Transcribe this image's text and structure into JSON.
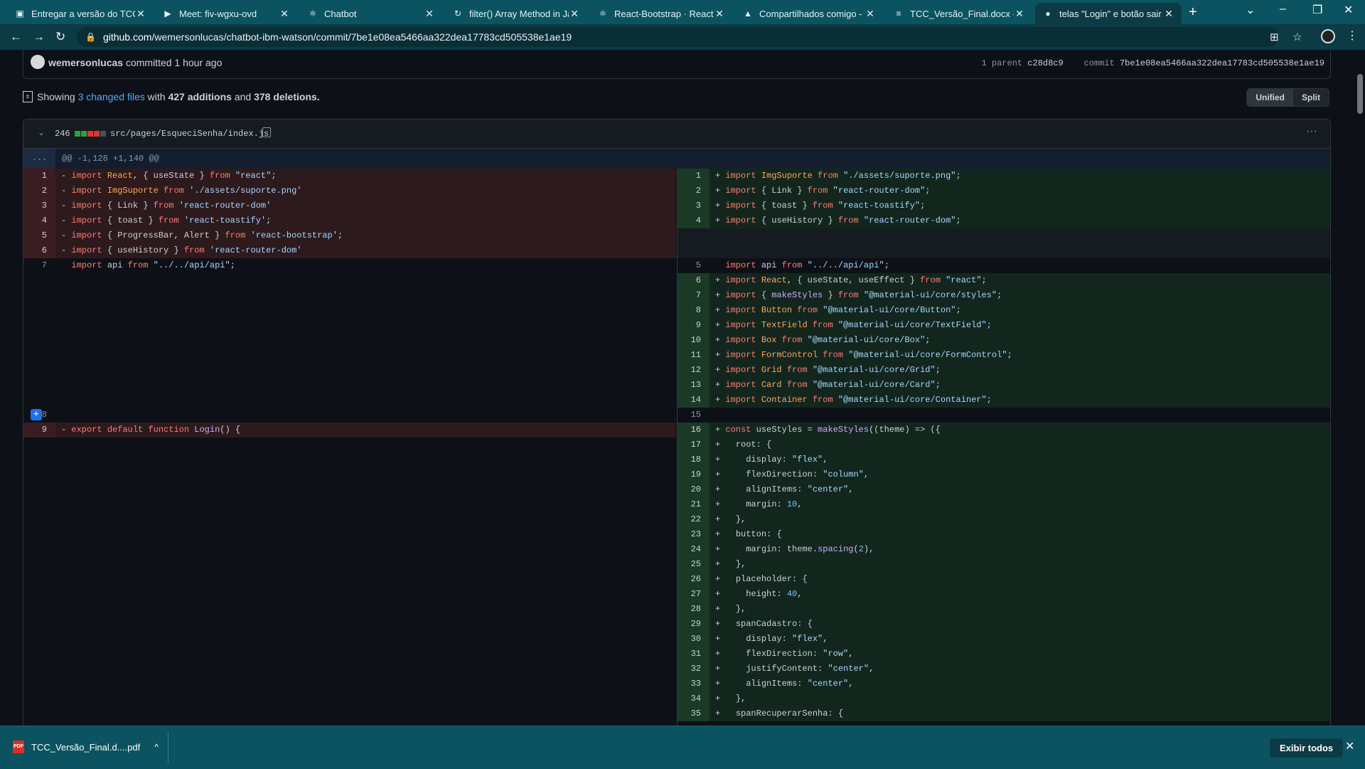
{
  "browser": {
    "tabs": [
      {
        "title": "Entregar a versão do TCC c",
        "icon": "classroom-icon"
      },
      {
        "title": "Meet: fiv-wgxu-ovd",
        "icon": "meet-icon"
      },
      {
        "title": "Chatbot",
        "icon": "react-icon"
      },
      {
        "title": "filter() Array Method in Jav",
        "icon": "refresh-icon"
      },
      {
        "title": "React-Bootstrap · React-Bo",
        "icon": "react-icon"
      },
      {
        "title": "Compartilhados comigo - ",
        "icon": "drive-icon"
      },
      {
        "title": "TCC_Versão_Final.docx - D",
        "icon": "docs-icon"
      },
      {
        "title": "telas \"Login\" e botão sair c",
        "icon": "github-icon"
      }
    ],
    "url_host": "github.com",
    "url_path": "/wemersonlucas/chatbot-ibm-watson/commit/7be1e08ea5466aa322dea17783cd505538e1ae19"
  },
  "commit": {
    "author": "wemersonlucas",
    "committed": "committed 1 hour ago",
    "parent_label": "1 parent",
    "parent_sha": "c28d8c9",
    "commit_label": "commit",
    "commit_sha": "7be1e08ea5466aa322dea17783cd505538e1ae19"
  },
  "summary": {
    "showing": "Showing",
    "changed": "3 changed files",
    "with": "with",
    "additions": "427 additions",
    "and": "and",
    "deletions": "378 deletions."
  },
  "view": {
    "unified": "Unified",
    "split": "Split"
  },
  "file": {
    "count": "246",
    "path": "src/pages/EsqueciSenha/index.js",
    "hunk_dots": "...",
    "hunk": "@@ -1,128 +1,140 @@",
    "left_lines": [
      {
        "n": "1",
        "t": "del",
        "code": "- import React, { useState } from \"react\";"
      },
      {
        "n": "2",
        "t": "del",
        "code": "- import ImgSuporte from './assets/suporte.png'"
      },
      {
        "n": "3",
        "t": "del",
        "code": "- import { Link } from 'react-router-dom'"
      },
      {
        "n": "4",
        "t": "del",
        "code": "- import { toast } from 'react-toastify';"
      },
      {
        "n": "5",
        "t": "del",
        "code": "- import { ProgressBar, Alert } from 'react-bootstrap';"
      },
      {
        "n": "6",
        "t": "del",
        "code": "- import { useHistory } from 'react-router-dom'"
      },
      {
        "n": "7",
        "t": "ctx",
        "code": "  import api from \"../../api/api\";"
      },
      {
        "n": "",
        "t": "blank",
        "code": ""
      },
      {
        "n": "",
        "t": "blank",
        "code": ""
      },
      {
        "n": "",
        "t": "blank",
        "code": ""
      },
      {
        "n": "",
        "t": "blank",
        "code": ""
      },
      {
        "n": "",
        "t": "blank",
        "code": ""
      },
      {
        "n": "",
        "t": "blank",
        "code": ""
      },
      {
        "n": "",
        "t": "blank",
        "code": ""
      },
      {
        "n": "",
        "t": "blank",
        "code": ""
      },
      {
        "n": "",
        "t": "blank",
        "code": ""
      },
      {
        "n": "8",
        "t": "ctx",
        "code": "",
        "expand": "+"
      },
      {
        "n": "9",
        "t": "del",
        "code": "- export default function Login() {"
      }
    ],
    "right_lines": [
      {
        "n": "1",
        "t": "add",
        "code": "+ import ImgSuporte from \"./assets/suporte.png\";"
      },
      {
        "n": "2",
        "t": "add",
        "code": "+ import { Link } from \"react-router-dom\";"
      },
      {
        "n": "3",
        "t": "add",
        "code": "+ import { toast } from \"react-toastify\";"
      },
      {
        "n": "4",
        "t": "add",
        "code": "+ import { useHistory } from \"react-router-dom\";"
      },
      {
        "n": "",
        "t": "empty",
        "code": ""
      },
      {
        "n": "",
        "t": "empty",
        "code": ""
      },
      {
        "n": "5",
        "t": "ctx",
        "code": "  import api from \"../../api/api\";"
      },
      {
        "n": "6",
        "t": "add",
        "code": "+ import React, { useState, useEffect } from \"react\";"
      },
      {
        "n": "7",
        "t": "add",
        "code": "+ import { makeStyles } from \"@material-ui/core/styles\";"
      },
      {
        "n": "8",
        "t": "add",
        "code": "+ import Button from \"@material-ui/core/Button\";"
      },
      {
        "n": "9",
        "t": "add",
        "code": "+ import TextField from \"@material-ui/core/TextField\";"
      },
      {
        "n": "10",
        "t": "add",
        "code": "+ import Box from \"@material-ui/core/Box\";"
      },
      {
        "n": "11",
        "t": "add",
        "code": "+ import FormControl from \"@material-ui/core/FormControl\";"
      },
      {
        "n": "12",
        "t": "add",
        "code": "+ import Grid from \"@material-ui/core/Grid\";"
      },
      {
        "n": "13",
        "t": "add",
        "code": "+ import Card from \"@material-ui/core/Card\";"
      },
      {
        "n": "14",
        "t": "add",
        "code": "+ import Container from \"@material-ui/core/Container\";"
      },
      {
        "n": "15",
        "t": "ctx",
        "code": ""
      },
      {
        "n": "16",
        "t": "add",
        "code": "+ const useStyles = makeStyles((theme) => ({"
      },
      {
        "n": "17",
        "t": "add",
        "code": "+   root: {"
      },
      {
        "n": "18",
        "t": "add",
        "code": "+     display: \"flex\","
      },
      {
        "n": "19",
        "t": "add",
        "code": "+     flexDirection: \"column\","
      },
      {
        "n": "20",
        "t": "add",
        "code": "+     alignItems: \"center\","
      },
      {
        "n": "21",
        "t": "add",
        "code": "+     margin: 10,"
      },
      {
        "n": "22",
        "t": "add",
        "code": "+   },"
      },
      {
        "n": "23",
        "t": "add",
        "code": "+   button: {"
      },
      {
        "n": "24",
        "t": "add",
        "code": "+     margin: theme.spacing(2),"
      },
      {
        "n": "25",
        "t": "add",
        "code": "+   },"
      },
      {
        "n": "26",
        "t": "add",
        "code": "+   placeholder: {"
      },
      {
        "n": "27",
        "t": "add",
        "code": "+     height: 40,"
      },
      {
        "n": "28",
        "t": "add",
        "code": "+   },"
      },
      {
        "n": "29",
        "t": "add",
        "code": "+   spanCadastro: {"
      },
      {
        "n": "30",
        "t": "add",
        "code": "+     display: \"flex\","
      },
      {
        "n": "31",
        "t": "add",
        "code": "+     flexDirection: \"row\","
      },
      {
        "n": "32",
        "t": "add",
        "code": "+     justifyContent: \"center\","
      },
      {
        "n": "33",
        "t": "add",
        "code": "+     alignItems: \"center\","
      },
      {
        "n": "34",
        "t": "add",
        "code": "+   },"
      },
      {
        "n": "35",
        "t": "add",
        "code": "+   spanRecuperarSenha: {"
      }
    ]
  },
  "download": {
    "filename": "TCC_Versão_Final.d....pdf",
    "pdf_badge": "PDF",
    "show_all": "Exibir todos"
  },
  "colors": {
    "tab_bar": "#0b5360",
    "add": "#12261e",
    "del": "#2d1a1d",
    "link": "#58a6ff"
  }
}
